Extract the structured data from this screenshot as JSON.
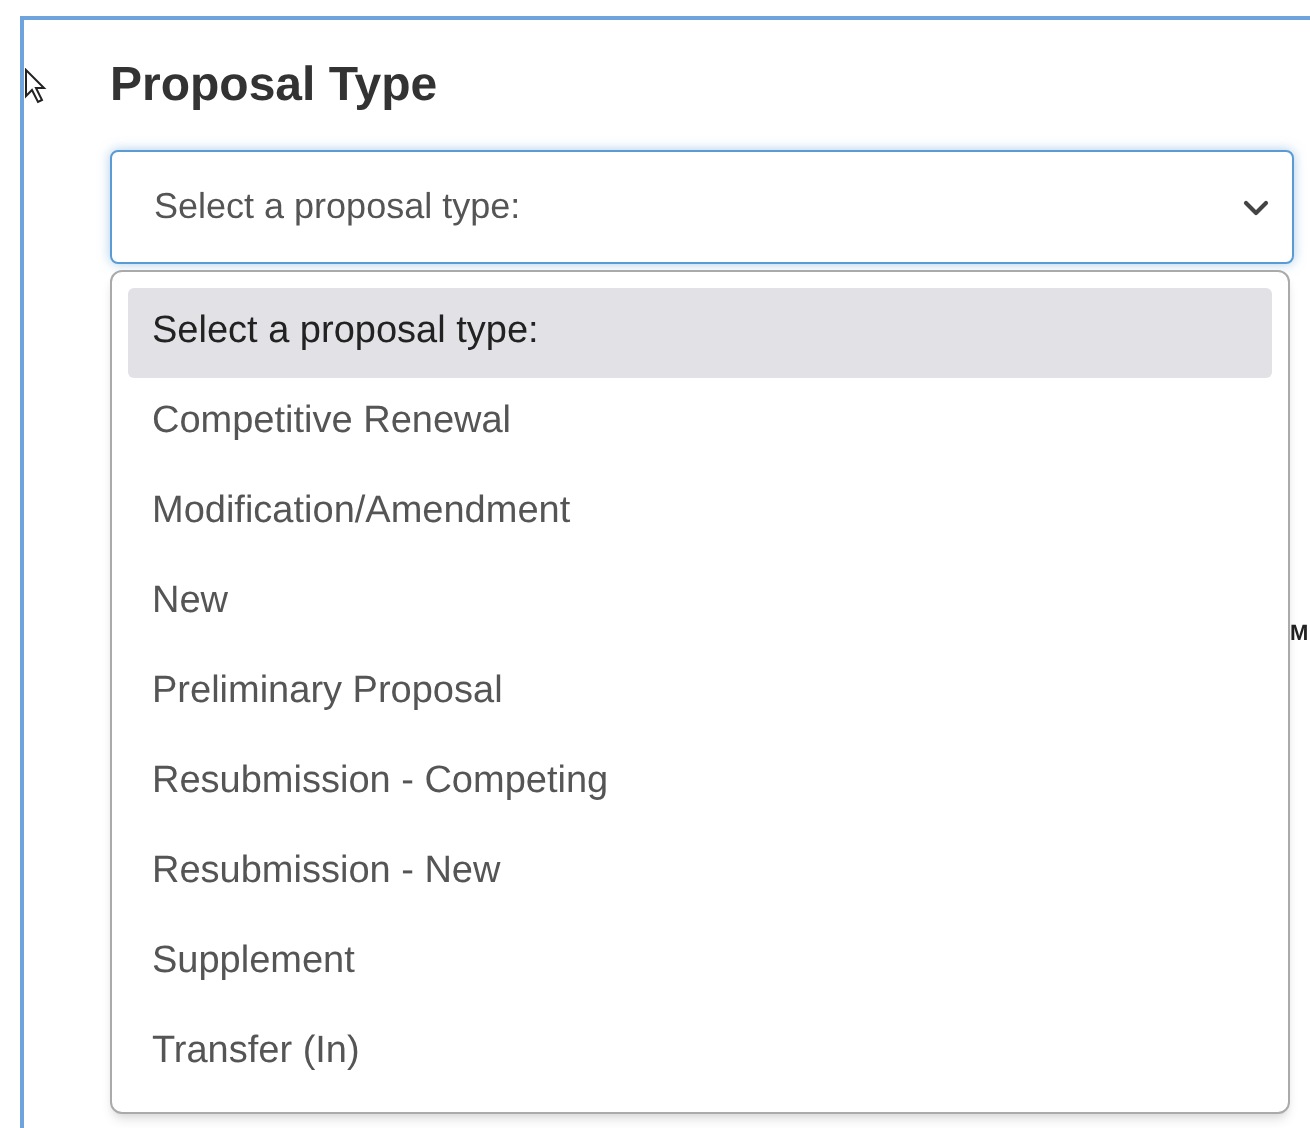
{
  "heading": "Proposal Type",
  "select": {
    "value": "Select a proposal type:",
    "expanded": true
  },
  "options": [
    {
      "label": "Select a proposal type:",
      "selected": true
    },
    {
      "label": "Competitive Renewal",
      "selected": false
    },
    {
      "label": "Modification/Amendment",
      "selected": false
    },
    {
      "label": "New",
      "selected": false
    },
    {
      "label": "Preliminary Proposal",
      "selected": false
    },
    {
      "label": "Resubmission - Competing",
      "selected": false
    },
    {
      "label": "Resubmission - New",
      "selected": false
    },
    {
      "label": "Supplement",
      "selected": false
    },
    {
      "label": "Transfer (In)",
      "selected": false
    }
  ],
  "background_heading": "M"
}
